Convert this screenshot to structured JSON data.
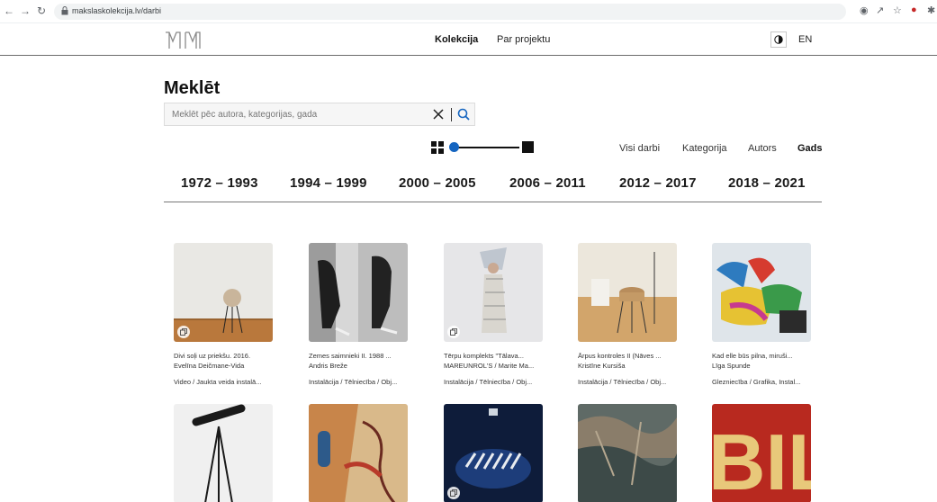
{
  "browser": {
    "url": "makslaskolekcija.lv/darbi"
  },
  "header": {
    "nav": [
      {
        "label": "Kolekcija",
        "active": true
      },
      {
        "label": "Par projektu",
        "active": false
      }
    ],
    "lang": "EN"
  },
  "search": {
    "title": "Meklēt",
    "placeholder": "Meklēt pēc autora, kategorijas, gada"
  },
  "filters": {
    "tabs": [
      {
        "label": "Visi darbi",
        "active": false
      },
      {
        "label": "Kategorija",
        "active": false
      },
      {
        "label": "Autors",
        "active": false
      },
      {
        "label": "Gads",
        "active": true
      }
    ]
  },
  "years": [
    "1972 – 1993",
    "1994 – 1999",
    "2000 – 2005",
    "2006 – 2011",
    "2012 – 2017",
    "2018 – 2021"
  ],
  "works": [
    {
      "title": "Divi soļi uz priekšu. 2016.",
      "author": "Evelīna Deičmane-Vida",
      "category": "Video / Jaukta veida instalā...",
      "multi": true
    },
    {
      "title": "Zemes saimnieki II. 1988 ...",
      "author": "Andris Breže",
      "category": "Instalācija / Tēlniecība / Obj...",
      "multi": false
    },
    {
      "title": "Tērpu komplekts \"Tālava...",
      "author": "MAREUNROL'S / Marite Ma...",
      "category": "Instalācija / Tēlniecība / Obj...",
      "multi": true
    },
    {
      "title": "Ārpus kontroles II (Nāves ...",
      "author": "Kristīne Kursiša",
      "category": "Instalācija / Tēlniecība / Obj...",
      "multi": false
    },
    {
      "title": "Kad elle būs pilna, miruši...",
      "author": "Līga Spunde",
      "category": "Glezniecība / Grafika, Instal...",
      "multi": false
    },
    {
      "title": "",
      "author": "",
      "category": "",
      "multi": false
    },
    {
      "title": "",
      "author": "",
      "category": "",
      "multi": false
    },
    {
      "title": "",
      "author": "",
      "category": "",
      "multi": true
    },
    {
      "title": "",
      "author": "",
      "category": "",
      "multi": false
    },
    {
      "title": "",
      "author": "",
      "category": "",
      "multi": false
    }
  ],
  "colors": {
    "accent": "#1565c0",
    "text": "#1a1a1a"
  }
}
